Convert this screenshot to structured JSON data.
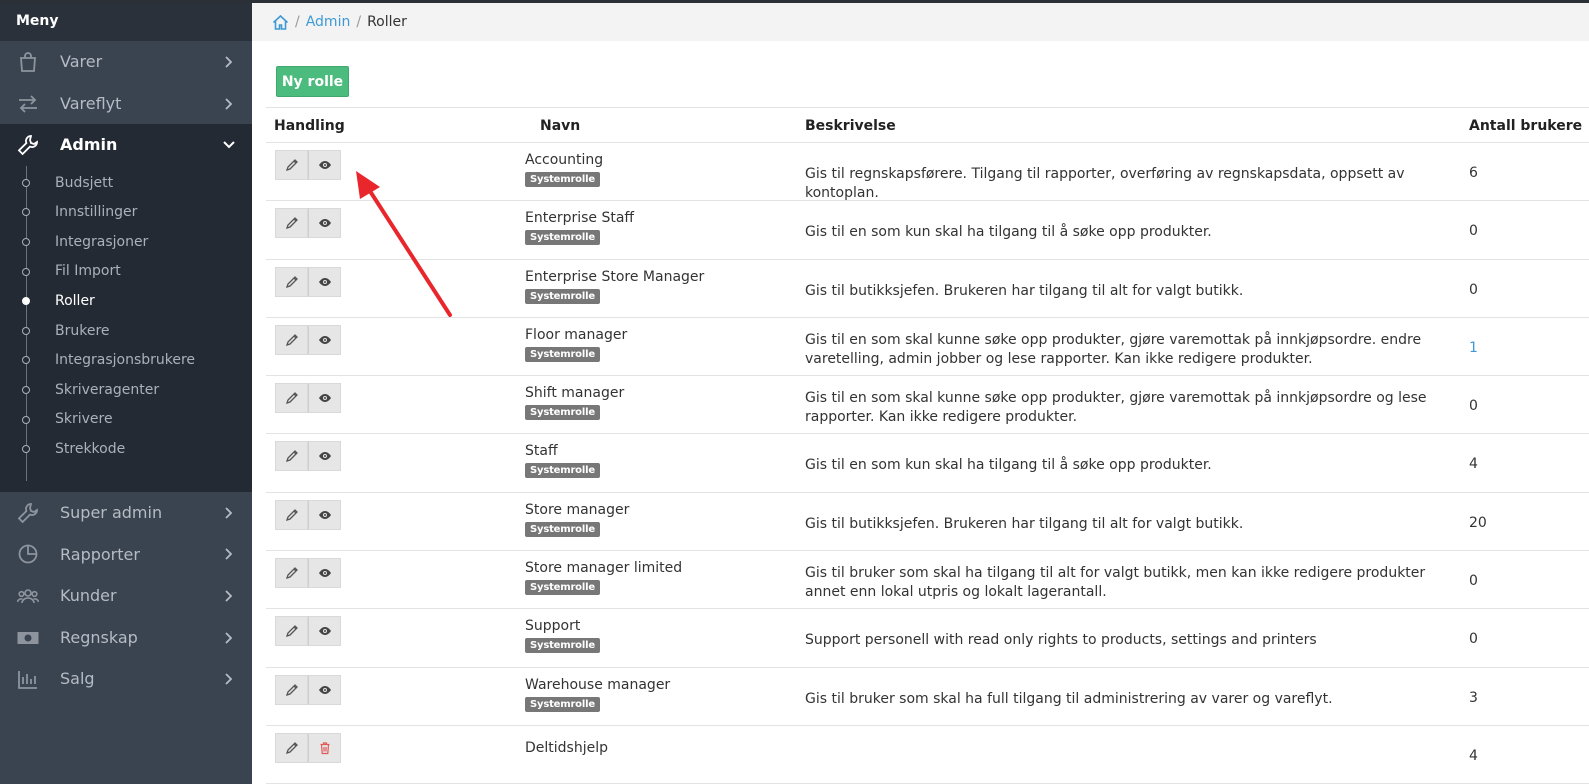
{
  "sidebar": {
    "header": "Meny",
    "items_top": [
      {
        "label": "Varer",
        "icon": "shopping-bag-icon"
      },
      {
        "label": "Vareflyt",
        "icon": "exchange-arrows-icon"
      }
    ],
    "active": {
      "label": "Admin",
      "icon": "wrench-icon"
    },
    "sub_items": [
      "Budsjett",
      "Innstillinger",
      "Integrasjoner",
      "Fil Import",
      "Roller",
      "Brukere",
      "Integrasjonsbrukere",
      "Skriveragenter",
      "Skrivere",
      "Strekkode"
    ],
    "current_sub": "Roller",
    "items_bottom": [
      {
        "label": "Super admin",
        "icon": "wrench-icon"
      },
      {
        "label": "Rapporter",
        "icon": "pie-chart-icon"
      },
      {
        "label": "Kunder",
        "icon": "users-icon"
      },
      {
        "label": "Regnskap",
        "icon": "money-icon"
      },
      {
        "label": "Salg",
        "icon": "bar-chart-icon"
      }
    ]
  },
  "breadcrumb": {
    "home_icon": "home-icon",
    "admin": "Admin",
    "current": "Roller",
    "separator": "/"
  },
  "new_button": "Ny rolle",
  "table": {
    "headers": {
      "action": "Handling",
      "name": "Navn",
      "description": "Beskrivelse",
      "users": "Antall brukere"
    },
    "badge": "Systemrolle",
    "rows": [
      {
        "name": "Accounting",
        "system": true,
        "description": "Gis til regnskapsførere. Tilgang til rapporter, overføring av regnskapsdata, oppsett av kontoplan.",
        "count": "6",
        "link": false
      },
      {
        "name": "Enterprise Staff",
        "system": true,
        "description": "Gis til en som kun skal ha tilgang til å søke opp produkter.",
        "count": "0",
        "link": false
      },
      {
        "name": "Enterprise Store Manager",
        "system": true,
        "description": "Gis til butikksjefen. Brukeren har tilgang til alt for valgt butikk.",
        "count": "0",
        "link": false
      },
      {
        "name": "Floor manager",
        "system": true,
        "description": "Gis til en som skal kunne søke opp produkter, gjøre varemottak på innkjøpsordre. endre varetelling, admin jobber og lese rapporter. Kan ikke redigere produkter.",
        "count": "1",
        "link": true
      },
      {
        "name": "Shift manager",
        "system": true,
        "description": "Gis til en som skal kunne søke opp produkter, gjøre varemottak på innkjøpsordre og lese rapporter. Kan ikke redigere produkter.",
        "count": "0",
        "link": false
      },
      {
        "name": "Staff",
        "system": true,
        "description": "Gis til en som kun skal ha tilgang til å søke opp produkter.",
        "count": "4",
        "link": false
      },
      {
        "name": "Store manager",
        "system": true,
        "description": "Gis til butikksjefen. Brukeren har tilgang til alt for valgt butikk.",
        "count": "20",
        "link": false
      },
      {
        "name": "Store manager limited",
        "system": true,
        "description": "Gis til bruker som skal ha tilgang til alt for valgt butikk, men kan ikke redigere produkter annet enn lokal utpris og lokalt lagerantall.",
        "count": "0",
        "link": false
      },
      {
        "name": "Support",
        "system": true,
        "description": "Support personell with read only rights to products, settings and printers",
        "count": "0",
        "link": false
      },
      {
        "name": "Warehouse manager",
        "system": true,
        "description": "Gis til bruker som skal ha full tilgang til administrering av varer og vareflyt.",
        "count": "3",
        "link": false
      },
      {
        "name": "Deltidshjelp",
        "system": false,
        "description": "",
        "count": "4",
        "link": false
      }
    ]
  },
  "colors": {
    "sidebar": "#3a4350",
    "sidebar_active": "#232a33",
    "accent": "#4cbc7e",
    "link": "#3d9ad6",
    "delete": "#e05a5a",
    "arrow": "#e8262b"
  }
}
